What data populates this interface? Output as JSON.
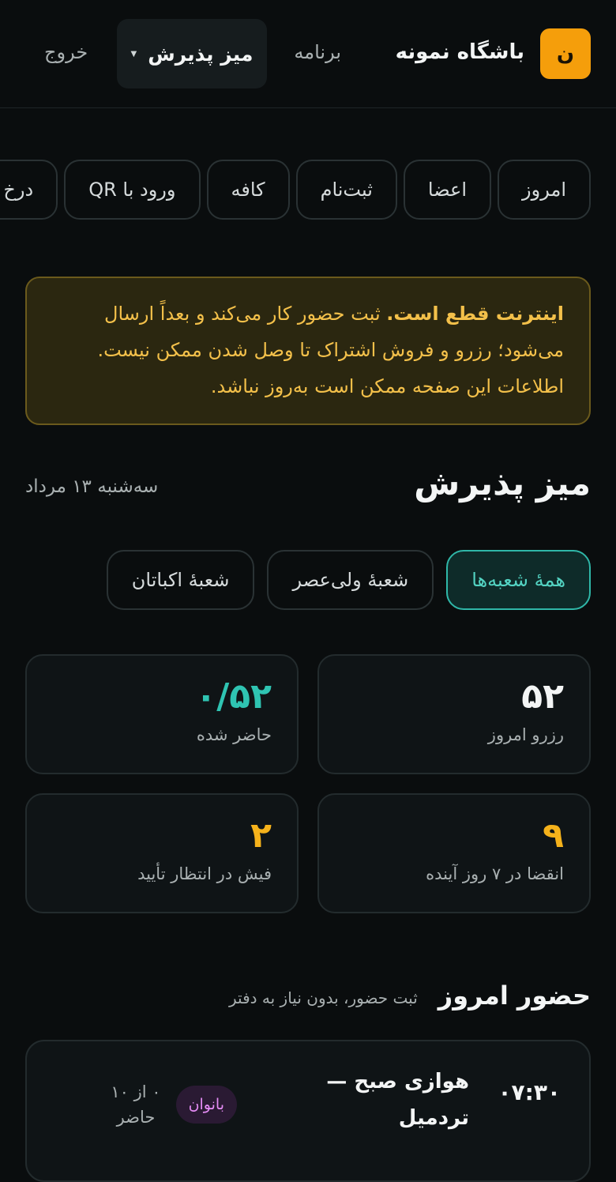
{
  "header": {
    "logo_letter": "ن",
    "club_name": "باشگاه نمونه",
    "nav_program": "برنامه",
    "nav_active": "میز پذیرش",
    "nav_logout": "خروج"
  },
  "tabs": [
    "امروز",
    "اعضا",
    "ثبت‌نام",
    "کافه",
    "ورود با QR",
    "درخ"
  ],
  "alert": {
    "bold": "اینترنت قطع است.",
    "text": " ثبت حضور کار می‌کند و بعداً ارسال می‌شود؛ رزرو و فروش اشتراک تا وصل شدن ممکن نیست. اطلاعات این صفحه ممکن است به‌روز نباشد."
  },
  "page": {
    "title": "میز پذیرش",
    "date": "سه‌شنبه ۱۳ مرداد"
  },
  "branches": [
    "همهٔ شعبه‌ها",
    "شعبهٔ ولی‌عصر",
    "شعبهٔ اکباتان"
  ],
  "stats": {
    "reservations": {
      "value": "۵۲",
      "label": "رزرو امروز"
    },
    "attended": {
      "value": "۰/۵۲",
      "label": "حاضر شده"
    },
    "expiring": {
      "value": "۹",
      "label": "انقضا در ۷ روز آینده"
    },
    "pending": {
      "value": "۲",
      "label": "فیش در انتظار تأیید"
    }
  },
  "section": {
    "title": "حضور امروز",
    "subtitle": "ثبت حضور، بدون نیاز به دفتر"
  },
  "class_item": {
    "time": "۰۷:۳۰",
    "name": "هوازی صبح — تردمیل",
    "badge": "بانوان",
    "count": "۰ از ۱۰ حاضر"
  },
  "colors": {
    "accent_teal": "#2fb7a8",
    "accent_amber": "#f59e0b",
    "badge_purple": "#e58cf5"
  }
}
